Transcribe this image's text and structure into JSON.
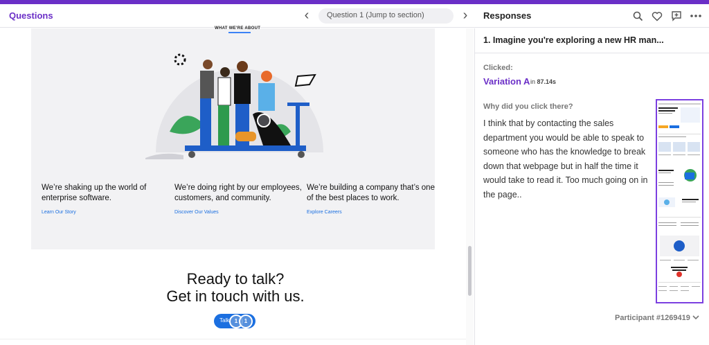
{
  "colors": {
    "brand": "#6b2fc7",
    "top_bar": "#6a2fc7",
    "link": "#1b6fe0"
  },
  "header": {
    "questions_title": "Questions",
    "question_selector": "Question 1 (Jump to section)",
    "responses_title": "Responses",
    "icons": [
      "search-icon",
      "heart-icon",
      "add-comment-icon",
      "more-icon"
    ]
  },
  "preview": {
    "tiny_heading": "WHAT WE'RE ABOUT",
    "columns": [
      {
        "text": "We’re shaking up the world of enterprise software.",
        "link": "Learn Our Story"
      },
      {
        "text": "We’re doing right by our employees, customers, and community.",
        "link": "Discover Our Values"
      },
      {
        "text": "We’re building a company that’s one of the best places to work.",
        "link": "Explore Careers"
      }
    ],
    "cta_line1": "Ready to talk?",
    "cta_line2": "Get in touch with us.",
    "talk_button": "Talk",
    "click_markers": [
      "1",
      "1"
    ]
  },
  "response": {
    "question": "1. Imagine you're exploring a new HR man...",
    "clicked_label": "Clicked:",
    "variation": "Variation A",
    "time_prefix": "in",
    "time": "87.14s",
    "why_label": "Why did you click there?",
    "answer": "I think that by contacting the sales department you would be able to speak to someone who has the knowledge to break down that webpage but in half the time it would take to read it. Too much going on in the page..",
    "participant": "Participant #1269419"
  }
}
